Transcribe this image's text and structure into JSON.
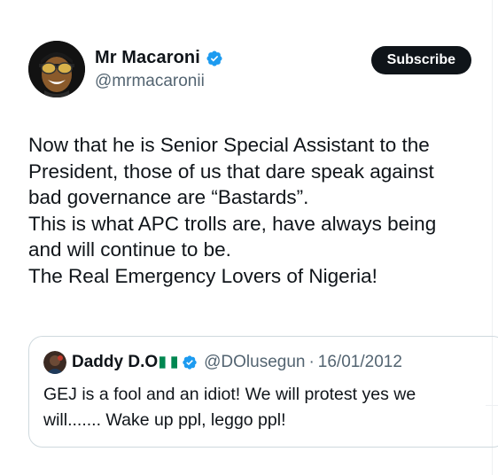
{
  "author": {
    "display_name": "Mr Macaroni",
    "handle": "@mrmacaronii",
    "verified": true,
    "avatar_icon": "avatar-sunglasses-icon"
  },
  "actions": {
    "subscribe_label": "Subscribe"
  },
  "tweet": {
    "lines": [
      "Now that he is Senior Special Assistant to the",
      "President, those of us that dare speak against",
      "bad governance are “Bastards”.",
      "This is what APC trolls are, have always being",
      "and will continue to be.",
      "The Real Emergency Lovers of Nigeria!"
    ]
  },
  "quoted_tweet": {
    "display_name": "Daddy D.O",
    "flag_icon": "nigeria-flag-icon",
    "verified": true,
    "handle": "@DOlusegun",
    "separator": "·",
    "date": "16/01/2012",
    "lines": [
      "GEJ is a fool and an idiot! We will protest yes we",
      "will....... Wake up ppl, leggo ppl!"
    ]
  },
  "colors": {
    "text": "#0f1419",
    "secondary": "#536471",
    "verified_blue": "#1d9bf0",
    "button_bg": "#0f1419",
    "border": "#cfd9de",
    "nigeria_green": "#008751"
  }
}
